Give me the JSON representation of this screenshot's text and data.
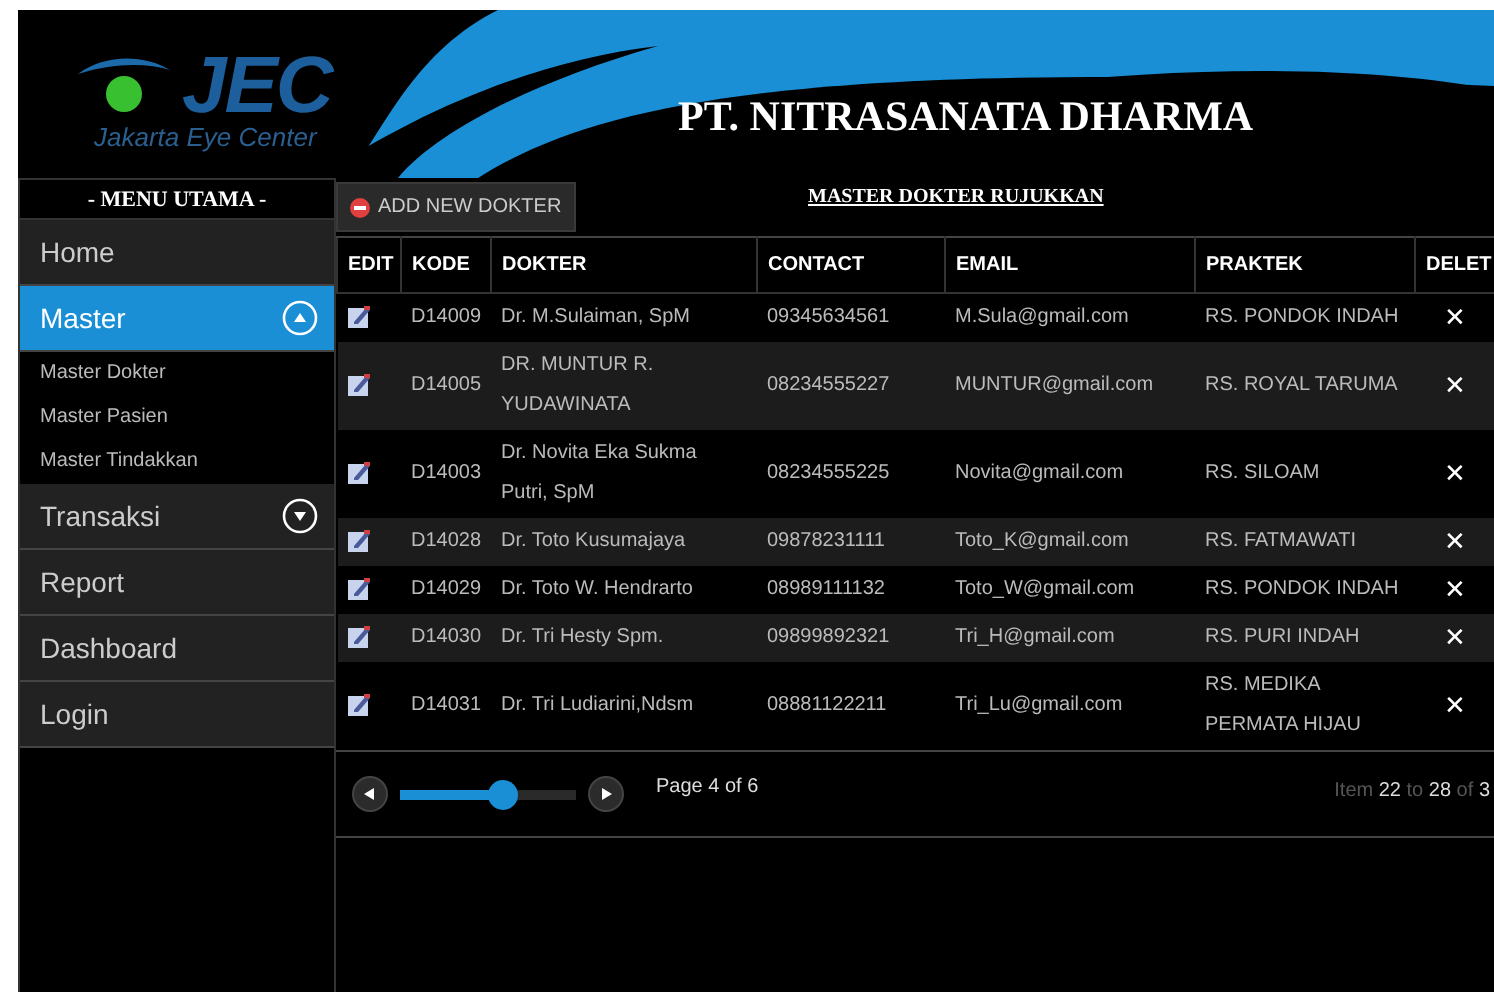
{
  "header": {
    "logo_mark": "JEC",
    "logo_caption": "Jakarta Eye Center",
    "title": "PT. NITRASANATA DHARMA"
  },
  "sidebar": {
    "title": "- MENU UTAMA -",
    "items": [
      {
        "kind": "link",
        "label": "Home",
        "selected": false
      },
      {
        "kind": "group",
        "label": "Master",
        "selected": true,
        "expanded": true,
        "children": [
          {
            "label": "Master Dokter"
          },
          {
            "label": "Master Pasien"
          },
          {
            "label": "Master Tindakkan"
          }
        ]
      },
      {
        "kind": "group",
        "label": "Transaksi",
        "selected": false,
        "expanded": false
      },
      {
        "kind": "link",
        "label": "Report",
        "selected": false
      },
      {
        "kind": "link",
        "label": "Dashboard",
        "selected": false
      },
      {
        "kind": "link",
        "label": "Login",
        "selected": false
      }
    ]
  },
  "toolbar": {
    "add_button": "ADD NEW DOKTER",
    "section_title": "MASTER DOKTER RUJUKKAN"
  },
  "table": {
    "columns": [
      "EDIT",
      "KODE",
      "DOKTER",
      "CONTACT",
      "EMAIL",
      "PRAKTEK",
      "DELET"
    ],
    "rows": [
      {
        "kode": "D14009",
        "dokter": "Dr. M.Sulaiman, SpM",
        "contact": "09345634561",
        "email": "M.Sula@gmail.com",
        "praktek": "RS. PONDOK INDAH",
        "delete": "✕"
      },
      {
        "kode": "D14005",
        "dokter": "DR. MUNTUR R. YUDAWINATA",
        "contact": "08234555227",
        "email": "MUNTUR@gmail.com",
        "praktek": "RS. ROYAL TARUMA",
        "delete": "✕"
      },
      {
        "kode": "D14003",
        "dokter": "Dr. Novita Eka Sukma Putri, SpM",
        "contact": "08234555225",
        "email": "Novita@gmail.com",
        "praktek": "RS. SILOAM",
        "delete": "✕"
      },
      {
        "kode": "D14028",
        "dokter": "Dr. Toto Kusumajaya",
        "contact": "09878231111",
        "email": "Toto_K@gmail.com",
        "praktek": "RS. FATMAWATI",
        "delete": "✕"
      },
      {
        "kode": "D14029",
        "dokter": "Dr. Toto W. Hendrarto",
        "contact": "08989111132",
        "email": "Toto_W@gmail.com",
        "praktek": "RS. PONDOK INDAH",
        "delete": "✕"
      },
      {
        "kode": "D14030",
        "dokter": "Dr. Tri Hesty Spm.",
        "contact": "09899892321",
        "email": "Tri_H@gmail.com",
        "praktek": "RS. PURI INDAH",
        "delete": "✕"
      },
      {
        "kode": "D14031",
        "dokter": "Dr. Tri Ludiarini,Ndsm",
        "contact": "08881122211",
        "email": "Tri_Lu@gmail.com",
        "praktek": "RS. MEDIKA PERMATA HIJAU",
        "delete": "✕"
      }
    ]
  },
  "pager": {
    "level": 0.6,
    "page_label": "Page 4 of 6",
    "range": "Item **22** to **28** of **3**"
  }
}
